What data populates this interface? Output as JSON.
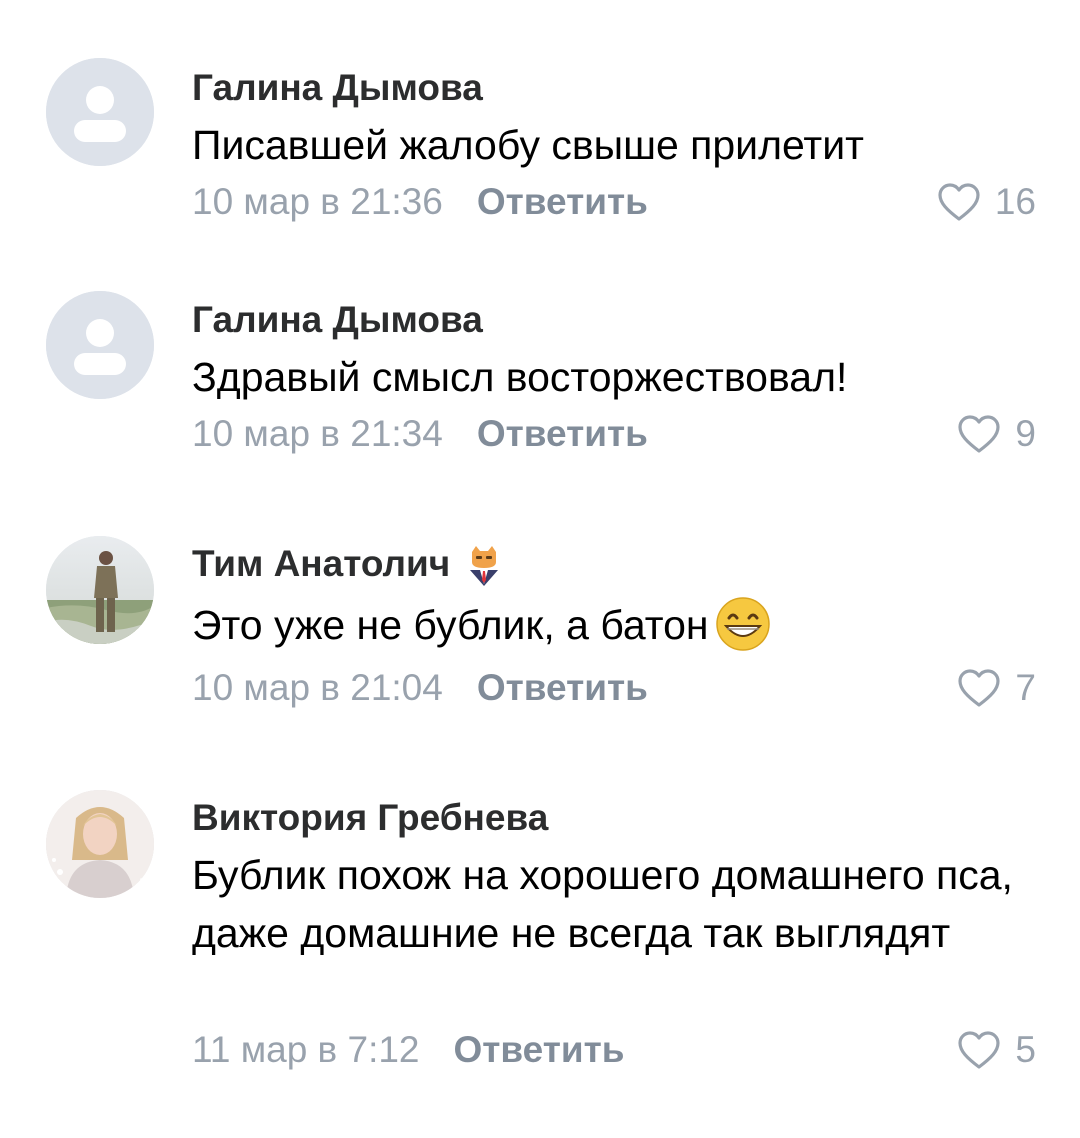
{
  "comments": [
    {
      "author": "Галина Дымова",
      "text": "Писавшей жалобу свыше прилетит",
      "date": "10 мар в 21:36",
      "reply_label": "Ответить",
      "likes": "16",
      "avatar_icon": "default-user-icon"
    },
    {
      "author": "Галина Дымова",
      "text": "Здравый смысл восторжествовал!",
      "date": "10 мар в 21:34",
      "reply_label": "Ответить",
      "likes": "9",
      "avatar_icon": "default-user-icon"
    },
    {
      "author": "Тим Анатолич",
      "text": "Это уже не бублик, а батон",
      "date": "10 мар в 21:04",
      "reply_label": "Ответить",
      "likes": "7",
      "avatar_icon": "user-photo",
      "badge_icon": "cat-in-suit-badge-icon",
      "text_emoji": "grinning-face-emoji"
    },
    {
      "author": "Виктория Гребнева",
      "text": "Бублик похож на хорошего домашнего пса, даже домашние не всегда так выглядят",
      "date": "11 мар в 7:12",
      "reply_label": "Ответить",
      "likes": "5",
      "avatar_icon": "user-photo"
    }
  ],
  "colors": {
    "author": "#2c2d2e",
    "meta": "#99a2ad",
    "reply": "#818c99",
    "placeholder_avatar": "#dde2ea"
  }
}
